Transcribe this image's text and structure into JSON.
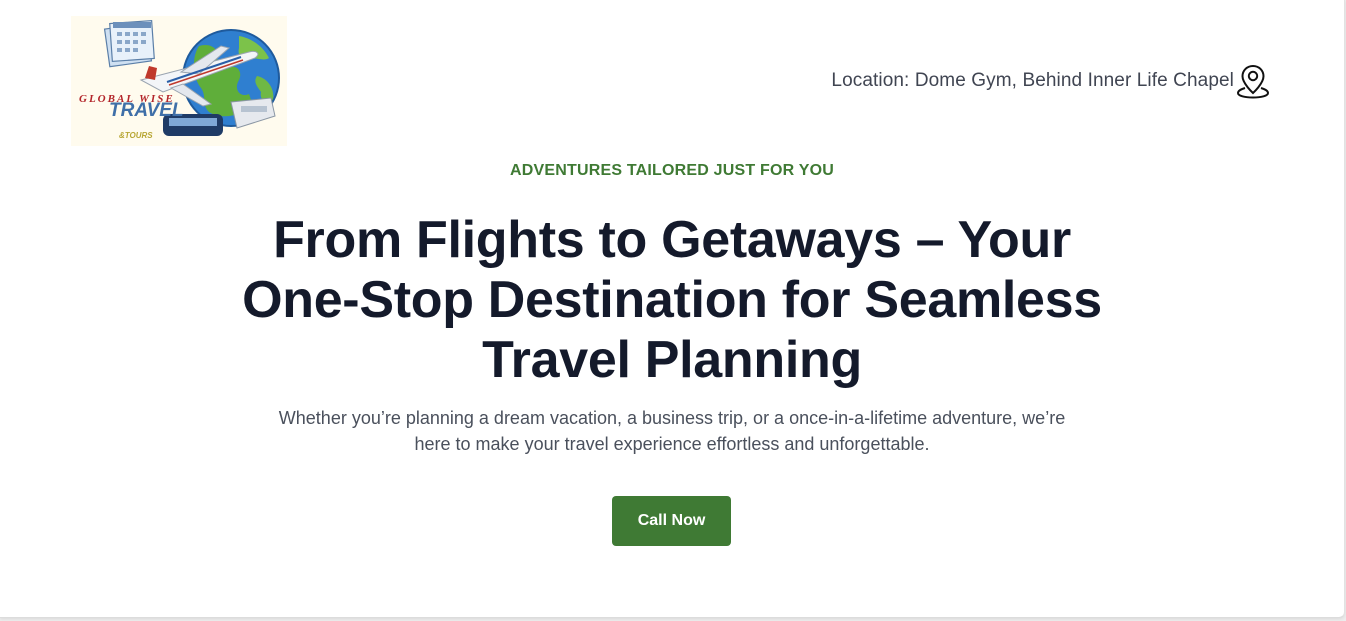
{
  "header": {
    "logo": {
      "wordmark_top": "GLOBAL WISE",
      "wordmark_main": "TRAVEL",
      "wordmark_bottom": "&TOURS"
    },
    "location": {
      "text": "Location: Dome Gym, Behind Inner Life Chapel",
      "icon": "map-pin-icon"
    }
  },
  "hero": {
    "eyebrow": "ADVENTURES TAILORED JUST FOR YOU",
    "headline": "From Flights to Getaways – Your One-Stop Destination for Seamless Travel Planning",
    "subtext": "Whether you’re planning a dream vacation, a business trip, or a once-in-a-lifetime adventure, we’re here to make your travel experience effortless and unforgettable.",
    "cta_label": "Call Now"
  },
  "colors": {
    "accent_green": "#3f7a34",
    "headline": "#141a2b",
    "body_text": "#4a505c",
    "page_background": "#ffffff"
  }
}
